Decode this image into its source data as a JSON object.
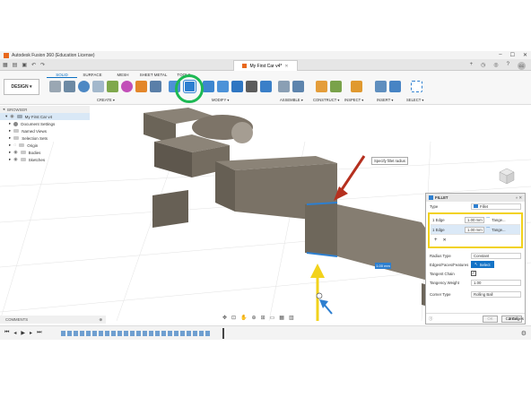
{
  "window": {
    "title": "Autodesk Fusion 360 (Education License)",
    "controls": [
      "–",
      "☐",
      "✕"
    ]
  },
  "doc_tab": {
    "label": "My First Car v4*"
  },
  "toolbar": {
    "workspace_button": "DESIGN ▾",
    "tabs": [
      "SOLID",
      "SURFACE",
      "MESH",
      "SHEET METAL",
      "TOOLS"
    ],
    "active_tab": "SOLID",
    "groups": [
      "CREATE ▾",
      "MODIFY ▾",
      "ASSEMBLE ▾",
      "CONSTRUCT ▾",
      "INSPECT ▾",
      "INSERT ▾",
      "SELECT ▾"
    ],
    "highlight_color": "#1db954"
  },
  "browser": {
    "header": "BROWSER",
    "items": [
      {
        "label": "My First Car v4"
      },
      {
        "label": "Document Settings"
      },
      {
        "label": "Named Views"
      },
      {
        "label": "Selection Sets"
      },
      {
        "label": "Origin"
      },
      {
        "label": "Bodies"
      },
      {
        "label": "Sketches"
      }
    ]
  },
  "viewport": {
    "tooltip": "Specify fillet radius",
    "radius_input": "1.00 mm",
    "arrow_colors": {
      "red": "#b5301f",
      "yellow": "#f2d21b",
      "blue": "#2d7fd0"
    }
  },
  "fillet_dialog": {
    "title": "FILLET",
    "type_label": "Type",
    "type_value": "Fillet",
    "selections": [
      {
        "edges": "1 Edge",
        "radius": "1.00 mm",
        "continuity": "Tange..."
      },
      {
        "edges": "1 Edge",
        "radius": "1.00 mm",
        "continuity": "Tange..."
      }
    ],
    "add_icon": "+",
    "remove_icon": "✕",
    "radius_type_label": "Radius Type",
    "radius_type_value": "Constant",
    "edges_label": "Edges/Faces/Features",
    "select_button": "Select",
    "tangent_chain_label": "Tangent Chain",
    "tangency_weight_label": "Tangency Weight",
    "tangency_weight_value": "1.00",
    "corner_type_label": "Corner Type",
    "corner_type_value": "Rolling Ball",
    "ok": "OK",
    "cancel": "Cancel",
    "frame_color": "#f2d21b"
  },
  "status": {
    "comments": "COMMENTS",
    "edges_count": "2 Edges"
  }
}
